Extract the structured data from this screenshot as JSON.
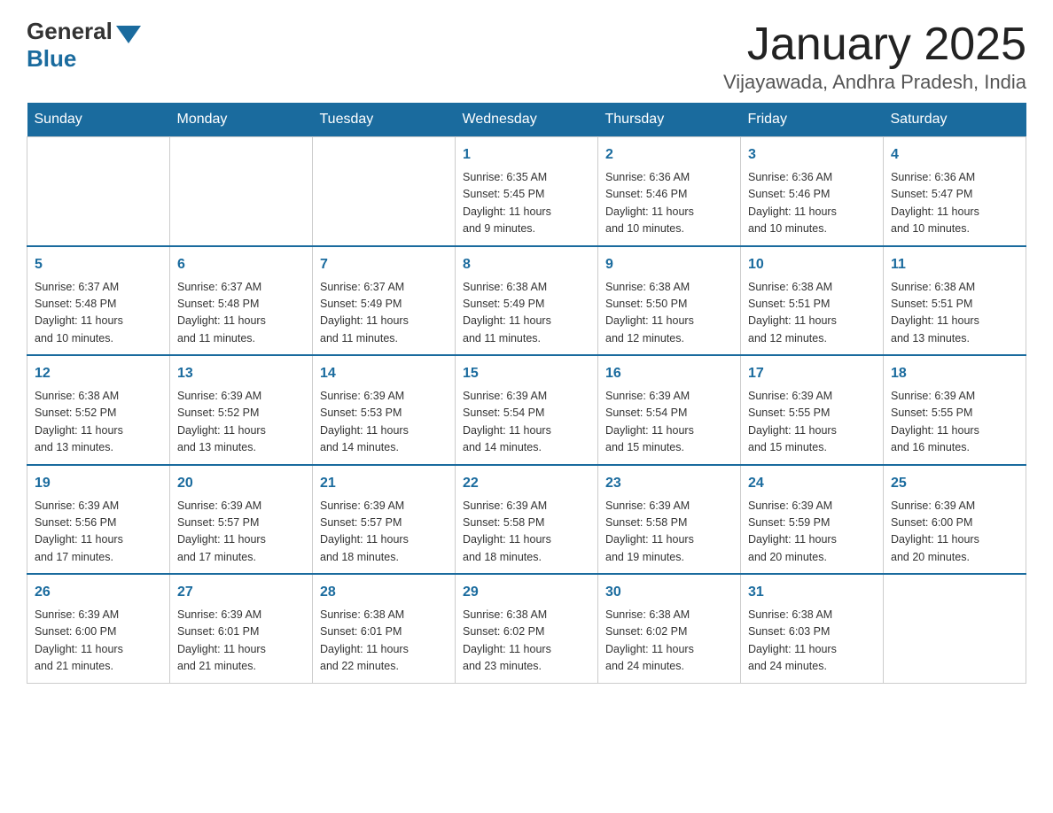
{
  "header": {
    "logo": {
      "general": "General",
      "blue": "Blue"
    },
    "title": "January 2025",
    "location": "Vijayawada, Andhra Pradesh, India"
  },
  "days_of_week": [
    "Sunday",
    "Monday",
    "Tuesday",
    "Wednesday",
    "Thursday",
    "Friday",
    "Saturday"
  ],
  "weeks": [
    [
      {
        "day": "",
        "info": ""
      },
      {
        "day": "",
        "info": ""
      },
      {
        "day": "",
        "info": ""
      },
      {
        "day": "1",
        "info": "Sunrise: 6:35 AM\nSunset: 5:45 PM\nDaylight: 11 hours\nand 9 minutes."
      },
      {
        "day": "2",
        "info": "Sunrise: 6:36 AM\nSunset: 5:46 PM\nDaylight: 11 hours\nand 10 minutes."
      },
      {
        "day": "3",
        "info": "Sunrise: 6:36 AM\nSunset: 5:46 PM\nDaylight: 11 hours\nand 10 minutes."
      },
      {
        "day": "4",
        "info": "Sunrise: 6:36 AM\nSunset: 5:47 PM\nDaylight: 11 hours\nand 10 minutes."
      }
    ],
    [
      {
        "day": "5",
        "info": "Sunrise: 6:37 AM\nSunset: 5:48 PM\nDaylight: 11 hours\nand 10 minutes."
      },
      {
        "day": "6",
        "info": "Sunrise: 6:37 AM\nSunset: 5:48 PM\nDaylight: 11 hours\nand 11 minutes."
      },
      {
        "day": "7",
        "info": "Sunrise: 6:37 AM\nSunset: 5:49 PM\nDaylight: 11 hours\nand 11 minutes."
      },
      {
        "day": "8",
        "info": "Sunrise: 6:38 AM\nSunset: 5:49 PM\nDaylight: 11 hours\nand 11 minutes."
      },
      {
        "day": "9",
        "info": "Sunrise: 6:38 AM\nSunset: 5:50 PM\nDaylight: 11 hours\nand 12 minutes."
      },
      {
        "day": "10",
        "info": "Sunrise: 6:38 AM\nSunset: 5:51 PM\nDaylight: 11 hours\nand 12 minutes."
      },
      {
        "day": "11",
        "info": "Sunrise: 6:38 AM\nSunset: 5:51 PM\nDaylight: 11 hours\nand 13 minutes."
      }
    ],
    [
      {
        "day": "12",
        "info": "Sunrise: 6:38 AM\nSunset: 5:52 PM\nDaylight: 11 hours\nand 13 minutes."
      },
      {
        "day": "13",
        "info": "Sunrise: 6:39 AM\nSunset: 5:52 PM\nDaylight: 11 hours\nand 13 minutes."
      },
      {
        "day": "14",
        "info": "Sunrise: 6:39 AM\nSunset: 5:53 PM\nDaylight: 11 hours\nand 14 minutes."
      },
      {
        "day": "15",
        "info": "Sunrise: 6:39 AM\nSunset: 5:54 PM\nDaylight: 11 hours\nand 14 minutes."
      },
      {
        "day": "16",
        "info": "Sunrise: 6:39 AM\nSunset: 5:54 PM\nDaylight: 11 hours\nand 15 minutes."
      },
      {
        "day": "17",
        "info": "Sunrise: 6:39 AM\nSunset: 5:55 PM\nDaylight: 11 hours\nand 15 minutes."
      },
      {
        "day": "18",
        "info": "Sunrise: 6:39 AM\nSunset: 5:55 PM\nDaylight: 11 hours\nand 16 minutes."
      }
    ],
    [
      {
        "day": "19",
        "info": "Sunrise: 6:39 AM\nSunset: 5:56 PM\nDaylight: 11 hours\nand 17 minutes."
      },
      {
        "day": "20",
        "info": "Sunrise: 6:39 AM\nSunset: 5:57 PM\nDaylight: 11 hours\nand 17 minutes."
      },
      {
        "day": "21",
        "info": "Sunrise: 6:39 AM\nSunset: 5:57 PM\nDaylight: 11 hours\nand 18 minutes."
      },
      {
        "day": "22",
        "info": "Sunrise: 6:39 AM\nSunset: 5:58 PM\nDaylight: 11 hours\nand 18 minutes."
      },
      {
        "day": "23",
        "info": "Sunrise: 6:39 AM\nSunset: 5:58 PM\nDaylight: 11 hours\nand 19 minutes."
      },
      {
        "day": "24",
        "info": "Sunrise: 6:39 AM\nSunset: 5:59 PM\nDaylight: 11 hours\nand 20 minutes."
      },
      {
        "day": "25",
        "info": "Sunrise: 6:39 AM\nSunset: 6:00 PM\nDaylight: 11 hours\nand 20 minutes."
      }
    ],
    [
      {
        "day": "26",
        "info": "Sunrise: 6:39 AM\nSunset: 6:00 PM\nDaylight: 11 hours\nand 21 minutes."
      },
      {
        "day": "27",
        "info": "Sunrise: 6:39 AM\nSunset: 6:01 PM\nDaylight: 11 hours\nand 21 minutes."
      },
      {
        "day": "28",
        "info": "Sunrise: 6:38 AM\nSunset: 6:01 PM\nDaylight: 11 hours\nand 22 minutes."
      },
      {
        "day": "29",
        "info": "Sunrise: 6:38 AM\nSunset: 6:02 PM\nDaylight: 11 hours\nand 23 minutes."
      },
      {
        "day": "30",
        "info": "Sunrise: 6:38 AM\nSunset: 6:02 PM\nDaylight: 11 hours\nand 24 minutes."
      },
      {
        "day": "31",
        "info": "Sunrise: 6:38 AM\nSunset: 6:03 PM\nDaylight: 11 hours\nand 24 minutes."
      },
      {
        "day": "",
        "info": ""
      }
    ]
  ]
}
